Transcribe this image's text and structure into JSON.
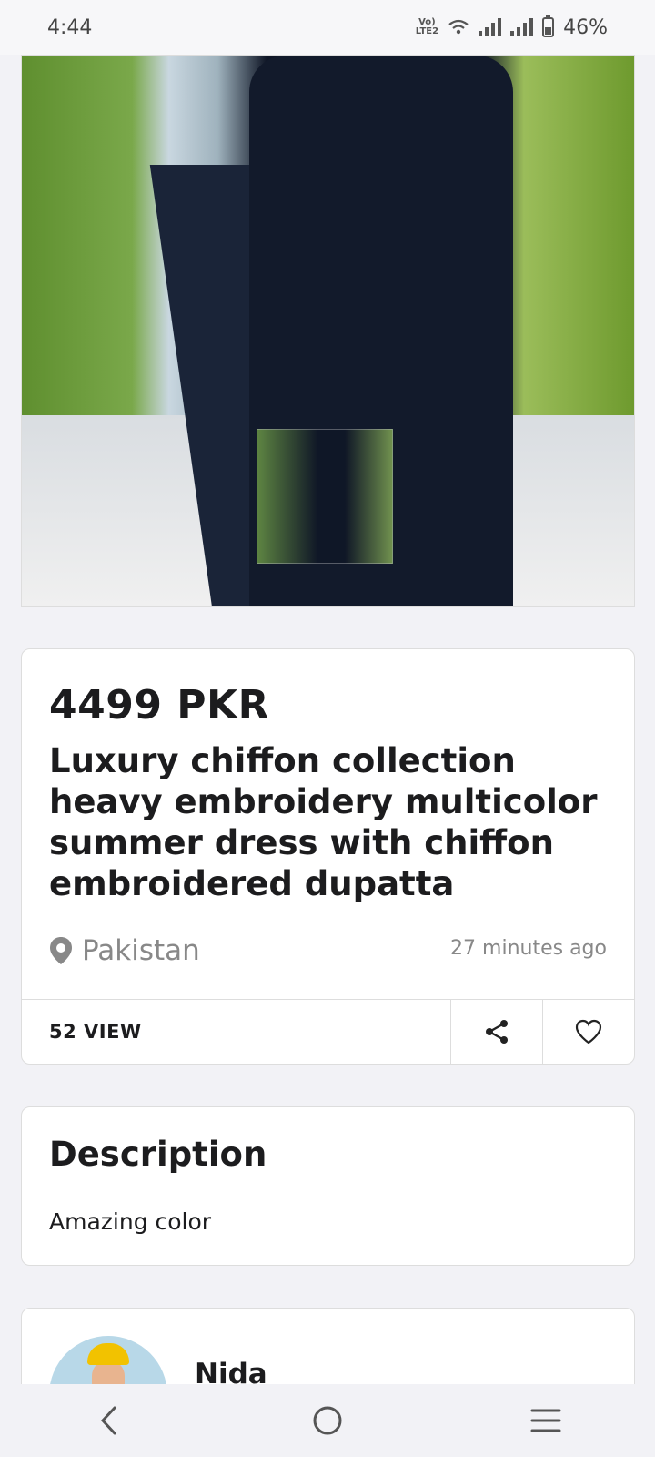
{
  "status_bar": {
    "time": "4:44",
    "network_label": "Vo)) LTE2",
    "battery": "46%"
  },
  "product": {
    "image_alt": "Woman wearing navy embroidered chiffon suit with dupatta",
    "price": "4499 PKR",
    "title": "Luxury chiffon collection heavy embroidery multicolor summer dress with chiffon embroidered dupatta",
    "location": "Pakistan",
    "posted": "27 minutes ago",
    "views": "52 VIEW"
  },
  "description": {
    "heading": "Description",
    "text": "Amazing color"
  },
  "seller": {
    "name": "Nida"
  },
  "icons": {
    "share": "share-icon",
    "favorite": "heart-icon",
    "location": "map-pin-icon",
    "back": "back-icon",
    "home": "home-icon",
    "menu": "menu-icon"
  },
  "colors": {
    "background": "#f2f2f6",
    "card": "#ffffff",
    "text": "#1c1c1e",
    "muted": "#888888"
  }
}
